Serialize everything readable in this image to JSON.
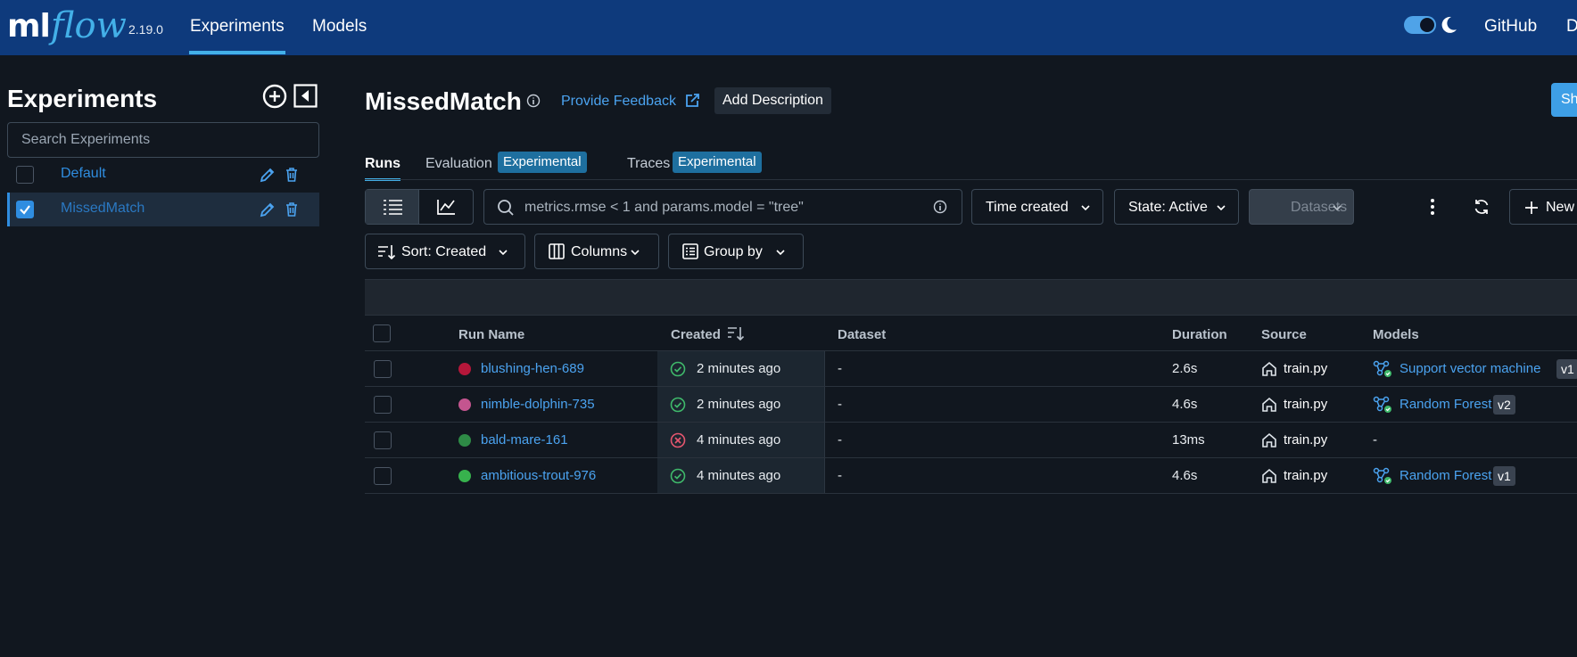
{
  "header": {
    "logo_ml": "ml",
    "logo_flow": "flow",
    "version": "2.19.0",
    "nav": [
      {
        "label": "Experiments",
        "active": true
      },
      {
        "label": "Models",
        "active": false
      }
    ],
    "github_label": "GitHub",
    "docs_label": "D",
    "theme_toggle_on": true,
    "bg_color": "#0e3a7c",
    "accent": "#43b0e8"
  },
  "sidebar": {
    "title": "Experiments",
    "search_placeholder": "Search Experiments",
    "experiments": [
      {
        "name": "Default",
        "checked": false
      },
      {
        "name": "MissedMatch",
        "checked": true
      }
    ]
  },
  "main": {
    "title": "MissedMatch",
    "feedback_label": "Provide Feedback",
    "add_description_label": "Add Description",
    "share_label": "Sh",
    "tabs": [
      {
        "label": "Runs",
        "active": true
      },
      {
        "label": "Evaluation",
        "tag": "Experimental"
      },
      {
        "label": "Traces",
        "tag": "Experimental"
      }
    ],
    "toolbar": {
      "filter_value": "metrics.rmse < 1 and params.model = \"tree\"",
      "time_created_label": "Time created",
      "state_label": "State: Active",
      "datasets_label": "Datasets",
      "new_run_label": "New",
      "sort_label": "Sort: Created",
      "columns_label": "Columns",
      "group_by_label": "Group by"
    },
    "table": {
      "headers": {
        "run_name": "Run Name",
        "created": "Created",
        "dataset": "Dataset",
        "duration": "Duration",
        "source": "Source",
        "models": "Models"
      },
      "rows": [
        {
          "name": "blushing-hen-689",
          "color": "#b5173a",
          "status": "success",
          "created": "2 minutes ago",
          "dataset": "-",
          "duration": "2.6s",
          "source": "train.py",
          "model": "Support vector machine",
          "model_version": "v1"
        },
        {
          "name": "nimble-dolphin-735",
          "color": "#c4558f",
          "status": "success",
          "created": "2 minutes ago",
          "dataset": "-",
          "duration": "4.6s",
          "source": "train.py",
          "model": "Random Forest",
          "model_version": "v2"
        },
        {
          "name": "bald-mare-161",
          "color": "#2e8b46",
          "status": "failed",
          "created": "4 minutes ago",
          "dataset": "-",
          "duration": "13ms",
          "source": "train.py",
          "model": "-",
          "model_version": ""
        },
        {
          "name": "ambitious-trout-976",
          "color": "#37b24d",
          "status": "success",
          "created": "4 minutes ago",
          "dataset": "-",
          "duration": "4.6s",
          "source": "train.py",
          "model": "Random Forest",
          "model_version": "v1"
        }
      ]
    }
  }
}
